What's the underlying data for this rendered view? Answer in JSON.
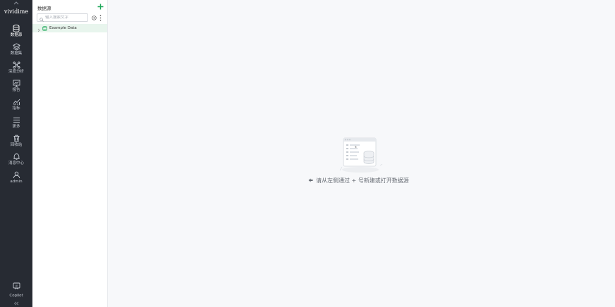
{
  "rail": {
    "brand": "vividime",
    "items": [
      {
        "label": "数据源",
        "icon": "database-icon",
        "active": true
      },
      {
        "label": "数据集",
        "icon": "layers-icon",
        "active": false
      },
      {
        "label": "深度分析",
        "icon": "analysis-icon",
        "active": false
      },
      {
        "label": "报告",
        "icon": "report-icon",
        "active": false
      },
      {
        "label": "指标",
        "icon": "metric-icon",
        "active": false
      },
      {
        "label": "更多",
        "icon": "menu-icon",
        "active": false
      },
      {
        "label": "回收站",
        "icon": "trash-icon",
        "active": false
      },
      {
        "label": "消息中心",
        "icon": "bell-icon",
        "active": false
      },
      {
        "label": "admin",
        "icon": "user-icon",
        "active": false
      }
    ],
    "copilot_label": "Copilot"
  },
  "panel": {
    "title": "数据源",
    "search_placeholder": "输入搜索文字",
    "tree": [
      {
        "label": "Example Data",
        "icon": "database-icon"
      }
    ]
  },
  "main": {
    "hint": "请从左侧通过 + 号新建或打开数据源"
  },
  "colors": {
    "rail_bg": "#272b33",
    "accent": "#1fa85a",
    "selected_row": "#e8f5ed"
  }
}
